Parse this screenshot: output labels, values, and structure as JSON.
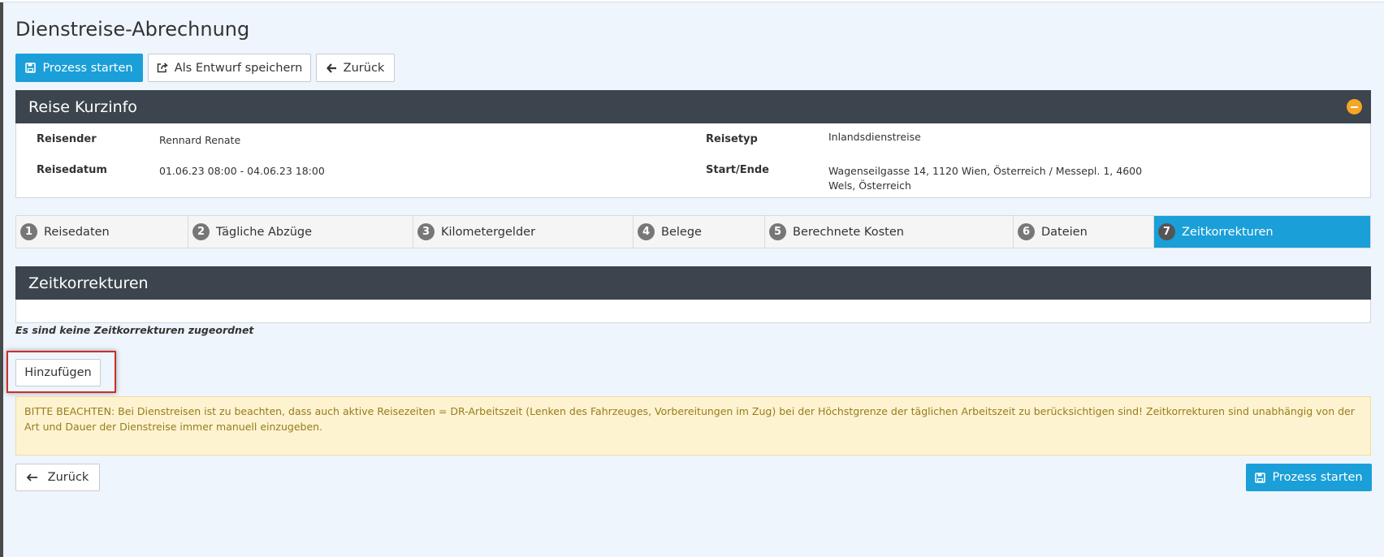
{
  "page": {
    "title": "Dienstreise-Abrechnung"
  },
  "toolbar": {
    "start_label": "Prozess starten",
    "draft_label": "Als Entwurf speichern",
    "back_label": "Zurück"
  },
  "kurzinfo": {
    "title": "Reise Kurzinfo",
    "reisender_label": "Reisender",
    "reisender_value": "Rennard Renate",
    "reisedatum_label": "Reisedatum",
    "reisedatum_value": "01.06.23 08:00 - 04.06.23 18:00",
    "reisetyp_label": "Reisetyp",
    "reisetyp_value": "Inlandsdienstreise",
    "startende_label": "Start/Ende",
    "startende_line1": "Wagenseilgasse 14, 1120 Wien, Österreich / Messepl. 1, 4600",
    "startende_line2": "Wels, Österreich"
  },
  "tabs": [
    {
      "num": "1",
      "label": "Reisedaten"
    },
    {
      "num": "2",
      "label": "Tägliche Abzüge"
    },
    {
      "num": "3",
      "label": "Kilometergelder"
    },
    {
      "num": "4",
      "label": "Belege"
    },
    {
      "num": "5",
      "label": "Berechnete Kosten"
    },
    {
      "num": "6",
      "label": "Dateien"
    },
    {
      "num": "7",
      "label": "Zeitkorrekturen"
    }
  ],
  "active_tab": "Zeitkorrekturen",
  "zeitkorrekturen": {
    "title": "Zeitkorrekturen",
    "empty_text": "Es sind keine Zeitkorrekturen zugeordnet",
    "add_label": "Hinzufügen"
  },
  "notice": {
    "text": "BITTE BEACHTEN: Bei Dienstreisen ist zu beachten, dass auch aktive Reisezeiten = DR-Arbeitszeit (Lenken des Fahrzeuges, Vorbereitungen im Zug) bei der Höchstgrenze der täglichen Arbeitszeit zu berücksichtigen sind! Zeitkorrekturen sind unabhängig von der Art und Dauer der Dienstreise immer manuell einzugeben."
  },
  "footer": {
    "back_label": "Zurück",
    "start_label": "Prozess starten"
  },
  "colors": {
    "primary": "#1a9fd8",
    "panel_header": "#3c454d",
    "collapse_icon": "#f5a623",
    "notice_bg": "#fdf3d0",
    "notice_text": "#9a7b1c",
    "highlight": "#c9302c"
  },
  "icons": {
    "start": "floppy-disk-icon",
    "draft": "share-export-icon",
    "back": "arrow-left-icon",
    "collapse": "minus-circle-icon"
  }
}
